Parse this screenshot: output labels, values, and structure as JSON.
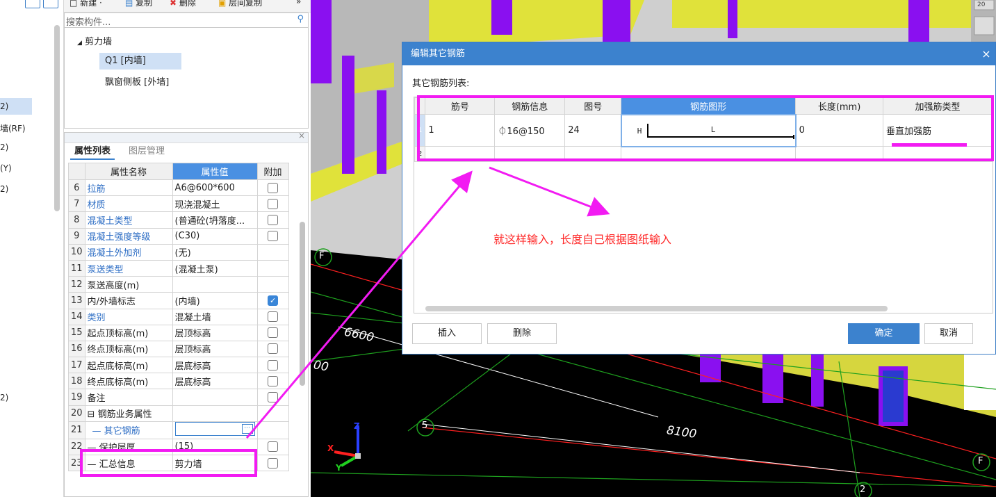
{
  "left_panel": {
    "items": [
      "2)",
      "墙(RF)",
      "2)",
      "(Y)",
      "2)",
      "2)"
    ]
  },
  "toolbar": {
    "new": "新建",
    "copy": "复制",
    "delete": "删除",
    "floor_copy": "层间复制",
    "more": "»"
  },
  "search": {
    "placeholder": "搜索构件..."
  },
  "tree": {
    "group": "剪力墙",
    "items": [
      "Q1 [内墙]",
      "飘窗侧板 [外墙]"
    ]
  },
  "props": {
    "tabs": [
      "属性列表",
      "图层管理"
    ],
    "headers": [
      "属性名称",
      "属性值",
      "附加"
    ],
    "rows": [
      {
        "n": "6",
        "name": "拉筋",
        "value": "A6@600*600",
        "blue": true,
        "check": "off"
      },
      {
        "n": "7",
        "name": "材质",
        "value": "现浇混凝土",
        "blue": true,
        "check": "off"
      },
      {
        "n": "8",
        "name": "混凝土类型",
        "value": "(普通砼(坍落度...",
        "blue": true,
        "check": "off"
      },
      {
        "n": "9",
        "name": "混凝土强度等级",
        "value": "(C30)",
        "blue": true,
        "check": "off"
      },
      {
        "n": "10",
        "name": "混凝土外加剂",
        "value": "(无)",
        "blue": true,
        "check": "none"
      },
      {
        "n": "11",
        "name": "泵送类型",
        "value": "(混凝土泵)",
        "blue": true,
        "check": "none"
      },
      {
        "n": "12",
        "name": "泵送高度(m)",
        "value": "",
        "blue": false,
        "check": "none"
      },
      {
        "n": "13",
        "name": "内/外墙标志",
        "value": "(内墙)",
        "blue": false,
        "check": "on"
      },
      {
        "n": "14",
        "name": "类别",
        "value": "混凝土墙",
        "blue": true,
        "check": "off"
      },
      {
        "n": "15",
        "name": "起点顶标高(m)",
        "value": "层顶标高",
        "blue": false,
        "check": "off"
      },
      {
        "n": "16",
        "name": "终点顶标高(m)",
        "value": "层顶标高",
        "blue": false,
        "check": "off"
      },
      {
        "n": "17",
        "name": "起点底标高(m)",
        "value": "层底标高",
        "blue": false,
        "check": "off"
      },
      {
        "n": "18",
        "name": "终点底标高(m)",
        "value": "层底标高",
        "blue": false,
        "check": "off"
      },
      {
        "n": "19",
        "name": "备注",
        "value": "",
        "blue": false,
        "check": "off"
      },
      {
        "n": "20",
        "name": "⊟ 钢筋业务属性",
        "value": "",
        "blue": false,
        "check": "none"
      },
      {
        "n": "21",
        "name": "— 其它钢筋",
        "value": "",
        "blue": true,
        "check": "none",
        "ellipsis": true
      },
      {
        "n": "22",
        "name": "— 保护层厚...",
        "value": "(15)",
        "blue": false,
        "check": "off"
      },
      {
        "n": "23",
        "name": "— 汇总信息",
        "value": "剪力墙",
        "blue": false,
        "check": "off"
      }
    ]
  },
  "dialog": {
    "title": "编辑其它钢筋",
    "list_label": "其它钢筋列表:",
    "headers": [
      "筋号",
      "钢筋信息",
      "图号",
      "钢筋图形",
      "长度(mm)",
      "加强筋类型"
    ],
    "rows": [
      {
        "n": "1",
        "bar": "1",
        "info": "⏀16@150",
        "shape_no": "24",
        "shape_h": "H",
        "shape_l": "L",
        "length": "0",
        "type": "垂直加强筋"
      },
      {
        "n": "2"
      }
    ],
    "buttons": {
      "insert": "插入",
      "delete": "删除",
      "ok": "确定",
      "cancel": "取消"
    }
  },
  "annotation": "就这样输入，长度自己根据图纸输入",
  "scene": {
    "dims": [
      "6600",
      "8100",
      "00"
    ],
    "axes": [
      "F",
      "5",
      "F",
      "2"
    ],
    "view_number": "20",
    "axis_x": "X",
    "axis_y": "Y",
    "axis_z": "Z"
  },
  "colors": {
    "accent": "#3c82ce",
    "highlight": "#f21bf2",
    "annotation": "#ff2a2a",
    "wall_yellow": "#e0e23a",
    "wall_purple": "#8a10f0"
  }
}
